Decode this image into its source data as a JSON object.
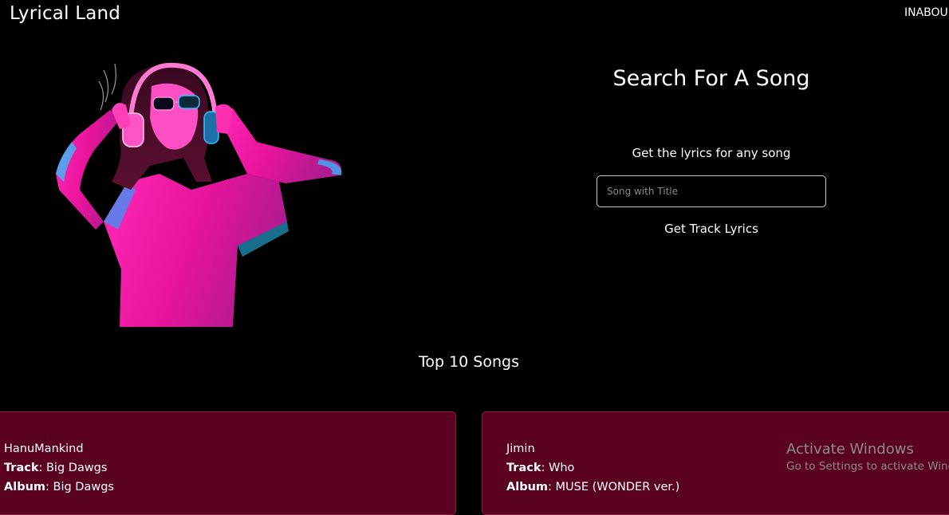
{
  "header": {
    "brand": "Lyrical Land",
    "nav_link": "INABOU"
  },
  "search": {
    "title": "Search For A Song",
    "subtitle": "Get the lyrics for any song",
    "placeholder": "Song with Title",
    "button_label": "Get Track Lyrics"
  },
  "top_songs": {
    "title": "Top 10 Songs",
    "track_label": "Track",
    "album_label": "Album",
    "cards": [
      {
        "artist": "HanuMankind",
        "track": "Big Dawgs",
        "album": "Big Dawgs"
      },
      {
        "artist": "Jimin",
        "track": "Who",
        "album": "MUSE (WONDER ver.)"
      }
    ]
  },
  "watermark": {
    "line1": "Activate Windows",
    "line2": "Go to Settings to activate Windows."
  },
  "colors": {
    "background": "#000000",
    "card": "#5a0020",
    "hero_pink": "#ff1aa8",
    "hero_cyan": "#28c8ff"
  }
}
